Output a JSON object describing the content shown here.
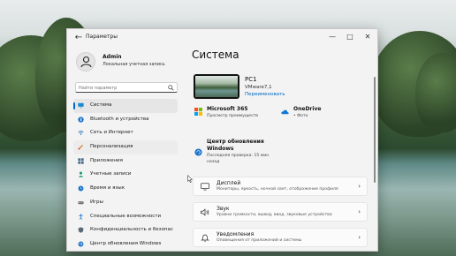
{
  "window": {
    "title": "Параметры",
    "controls": {
      "minimize": "—",
      "maximize": "□",
      "close": "✕"
    }
  },
  "user": {
    "name": "Admin",
    "account_type": "Локальная учетная запись"
  },
  "search": {
    "placeholder": "Найти параметр"
  },
  "sidebar": {
    "items": [
      {
        "label": "Система",
        "icon": "monitor-icon",
        "active": true
      },
      {
        "label": "Bluetooth и устройства",
        "icon": "bluetooth-icon"
      },
      {
        "label": "Сеть и Интернет",
        "icon": "network-icon"
      },
      {
        "label": "Персонализация",
        "icon": "brush-icon"
      },
      {
        "label": "Приложения",
        "icon": "apps-icon"
      },
      {
        "label": "Учетные записи",
        "icon": "account-icon"
      },
      {
        "label": "Время и язык",
        "icon": "clock-globe-icon"
      },
      {
        "label": "Игры",
        "icon": "gamepad-icon"
      },
      {
        "label": "Специальные возможности",
        "icon": "accessibility-icon"
      },
      {
        "label": "Конфиденциальность и безопас",
        "icon": "shield-icon"
      },
      {
        "label": "Центр обновления Windows",
        "icon": "update-icon"
      }
    ]
  },
  "main": {
    "title": "Система",
    "device": {
      "name": "PC1",
      "model": "VMware7,1",
      "rename_label": "Переименовать"
    },
    "microsoft365": {
      "title": "Microsoft 365",
      "subtitle": "Просмотр преимуществ"
    },
    "onedrive": {
      "title": "OneDrive",
      "subtitle": "• Фото"
    },
    "update": {
      "title_line1": "Центр обновления",
      "title_line2": "Windows",
      "subtitle_line1": "Последняя проверка: 15 мин",
      "subtitle_line2": "назад"
    },
    "cards": [
      {
        "title": "Дисплей",
        "subtitle": "Мониторы, яркость, ночной свет, отображение профиля",
        "icon": "display-icon"
      },
      {
        "title": "Звук",
        "subtitle": "Уровни громкости, вывод, ввод, звуковые устройства",
        "icon": "speaker-icon"
      },
      {
        "title": "Уведомления",
        "subtitle": "Оповещения от приложений и системы",
        "icon": "bell-icon"
      }
    ]
  },
  "colors": {
    "accent": "#0067c0",
    "window_bg": "#f3f3f3",
    "card_bg": "#fbfbfb"
  }
}
